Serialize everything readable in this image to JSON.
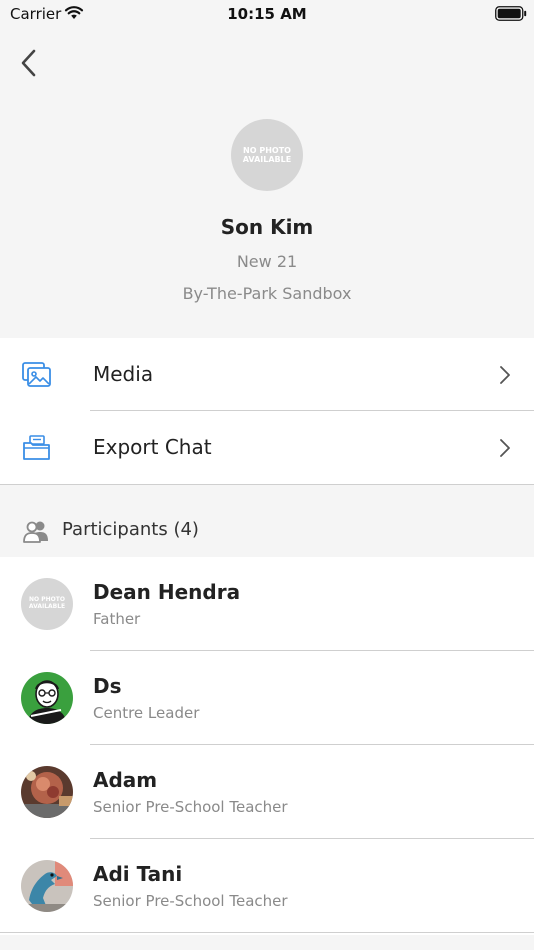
{
  "status_bar": {
    "carrier": "Carrier",
    "time": "10:15 AM"
  },
  "navigation": {
    "back_icon": "chevron-left-icon"
  },
  "profile": {
    "avatar_placeholder_line1": "NO PHOTO",
    "avatar_placeholder_line2": "AVAILABLE",
    "name": "Son Kim",
    "class_name": "New 21",
    "centre": "By-The-Park Sandbox"
  },
  "menu": {
    "items": [
      {
        "label": "Media",
        "icon": "image-gallery-icon"
      },
      {
        "label": "Export Chat",
        "icon": "export-folder-icon"
      }
    ]
  },
  "participants": {
    "header": "Participants (4)",
    "icon": "people-icon",
    "list": [
      {
        "name": "Dean Hendra",
        "role": "Father",
        "avatar": "no-photo"
      },
      {
        "name": "Ds",
        "role": "Centre Leader",
        "avatar": "cartoon-portrait"
      },
      {
        "name": "Adam",
        "role": "Senior Pre-School Teacher",
        "avatar": "photo"
      },
      {
        "name": "Adi Tani",
        "role": "Senior Pre-School Teacher",
        "avatar": "dinosaur-toy-photo"
      }
    ]
  },
  "colors": {
    "accent_blue": "#3a8ee6",
    "background": "#f5f5f5",
    "card": "#ffffff",
    "divider": "#cfcfcf",
    "placeholder": "#d6d6d6",
    "secondary_text": "#8a8a8a"
  }
}
